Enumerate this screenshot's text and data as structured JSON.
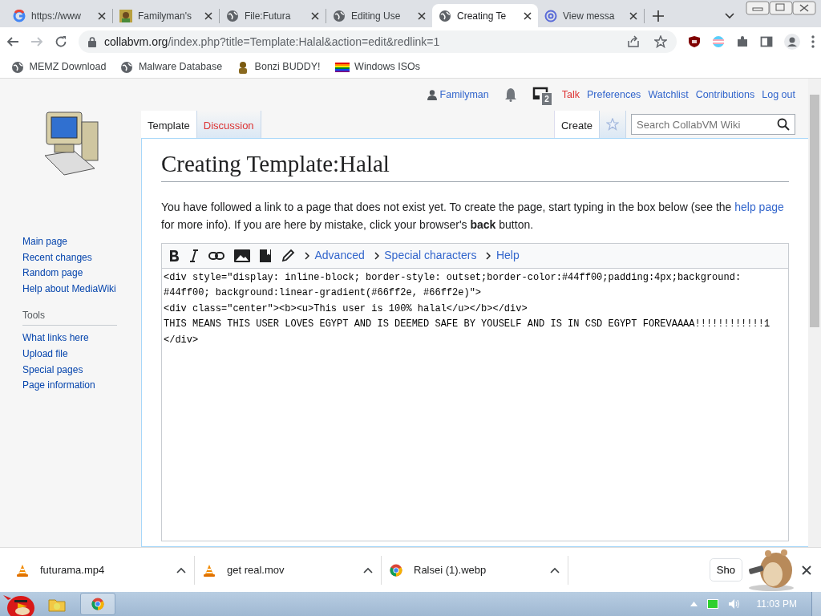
{
  "browser": {
    "tabs": [
      {
        "title": "https://www",
        "selected": false
      },
      {
        "title": "Familyman's",
        "selected": false
      },
      {
        "title": "File:Futura",
        "selected": false
      },
      {
        "title": "Editing Use",
        "selected": false
      },
      {
        "title": "Creating Te",
        "selected": true
      },
      {
        "title": "View messa",
        "selected": false
      }
    ],
    "forward_disabled": true,
    "address_host": "collabvm.org",
    "address_path": "/index.php?title=Template:Halal&action=edit&redlink=1",
    "bookmarks": [
      {
        "label": "MEMZ Download"
      },
      {
        "label": "Malware Database"
      },
      {
        "label": "Bonzi BUDDY!"
      },
      {
        "label": "Windows ISOs"
      }
    ]
  },
  "wiki": {
    "user_links": [
      {
        "label": "Familyman",
        "kind": "user",
        "new": false
      },
      {
        "label": "2",
        "kind": "messages"
      },
      {
        "label": "Talk",
        "kind": "link",
        "new": true
      },
      {
        "label": "Preferences",
        "kind": "link",
        "new": false
      },
      {
        "label": "Watchlist",
        "kind": "link",
        "new": false
      },
      {
        "label": "Contributions",
        "kind": "link",
        "new": false
      },
      {
        "label": "Log out",
        "kind": "link",
        "new": false
      }
    ],
    "namespace_tabs": [
      {
        "label": "Template",
        "selected": true,
        "new": false
      },
      {
        "label": "Discussion",
        "selected": false,
        "new": true
      }
    ],
    "view_tabs": [
      {
        "label": "Create",
        "selected": true
      }
    ],
    "search": {
      "placeholder": "Search CollabVM Wiki"
    },
    "navigation": [
      {
        "label": "Main page"
      },
      {
        "label": "Recent changes"
      },
      {
        "label": "Random page"
      },
      {
        "label": "Help about MediaWiki"
      }
    ],
    "tools_heading": "Tools",
    "tools": [
      {
        "label": "What links here"
      },
      {
        "label": "Upload file"
      },
      {
        "label": "Special pages"
      },
      {
        "label": "Page information"
      }
    ],
    "heading": "Creating Template:Halal",
    "intro": [
      {
        "kind": "text",
        "text": "You have followed a link to a page that does not exist yet. To create the page, start typing in the box below (see the"
      },
      {
        "kind": "link",
        "text": "help page"
      },
      {
        "kind": "text",
        "text": "for more info). If you are here by mistake, click your browser's **back** button."
      }
    ],
    "editor_menus": [
      {
        "label": "Advanced"
      },
      {
        "label": "Special characters"
      },
      {
        "label": "Help"
      }
    ],
    "editor_text": [
      "<div style=\"display: inline-block; border-style: outset;border-color:#44ff00;padding:4px;background: #44ff00; background:linear-gradient(#66ff2e, #66ff2e)\">",
      "<div class=\"center\"><b><u>This user is 100% halal</u></b></div>",
      "THIS MEANS THIS USER LOVES EGYPT AND IS DEEMED SAFE BY YOUSELF AND IS IN CSD EGYPT FOREVAAAA!!!!!!!!!!!!1",
      "</div>"
    ]
  },
  "downloads": {
    "items": [
      {
        "filename": "futurama.mp4"
      },
      {
        "filename": "get real.mov"
      },
      {
        "filename": "Ralsei (1).webp"
      }
    ],
    "show_all": "Sho"
  },
  "taskbar": {
    "clock": "11:03 PM"
  }
}
